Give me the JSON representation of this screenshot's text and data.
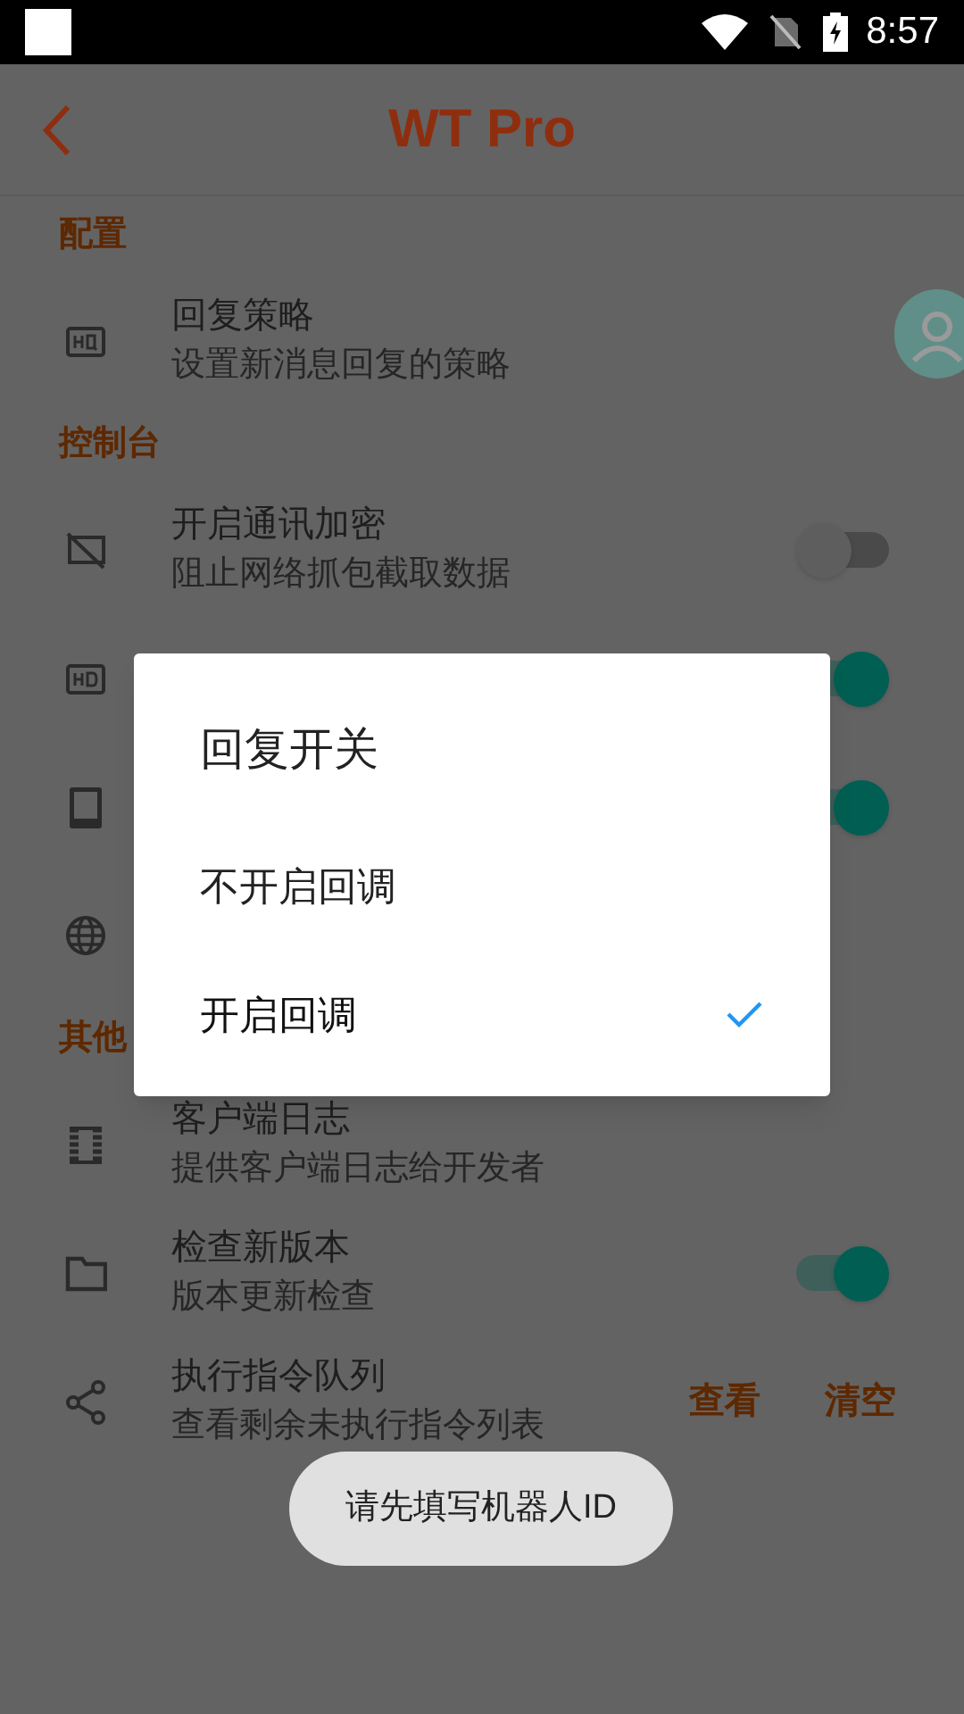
{
  "status_bar": {
    "time": "8:57"
  },
  "app_bar": {
    "title": "WT Pro"
  },
  "sections": [
    {
      "header": "配置",
      "rows": [
        {
          "kind": "plain",
          "title": "回复策略",
          "subtitle": "设置新消息回复的策略"
        }
      ]
    },
    {
      "header": "控制台",
      "rows": [
        {
          "kind": "toggle",
          "title": "开启通讯加密",
          "subtitle": "阻止网络抓包截取数据",
          "on": false
        },
        {
          "kind": "toggle",
          "on": true
        },
        {
          "kind": "toggle",
          "on": true
        },
        {
          "kind": "plain"
        }
      ]
    },
    {
      "header": "其他",
      "rows": [
        {
          "kind": "plain",
          "title": "客户端日志",
          "subtitle": "提供客户端日志给开发者"
        },
        {
          "kind": "toggle",
          "title": "检查新版本",
          "subtitle": "版本更新检查",
          "on": true
        },
        {
          "kind": "buttons",
          "title": "执行指令队列",
          "subtitle": "查看剩余未执行指令列表",
          "buttons": [
            "查看",
            "清空"
          ]
        }
      ]
    }
  ],
  "dialog": {
    "title": "回复开关",
    "options": [
      {
        "label": "不开启回调",
        "selected": false
      },
      {
        "label": "开启回调",
        "selected": true
      }
    ]
  },
  "toast": {
    "text": "请先填写机器人ID"
  }
}
